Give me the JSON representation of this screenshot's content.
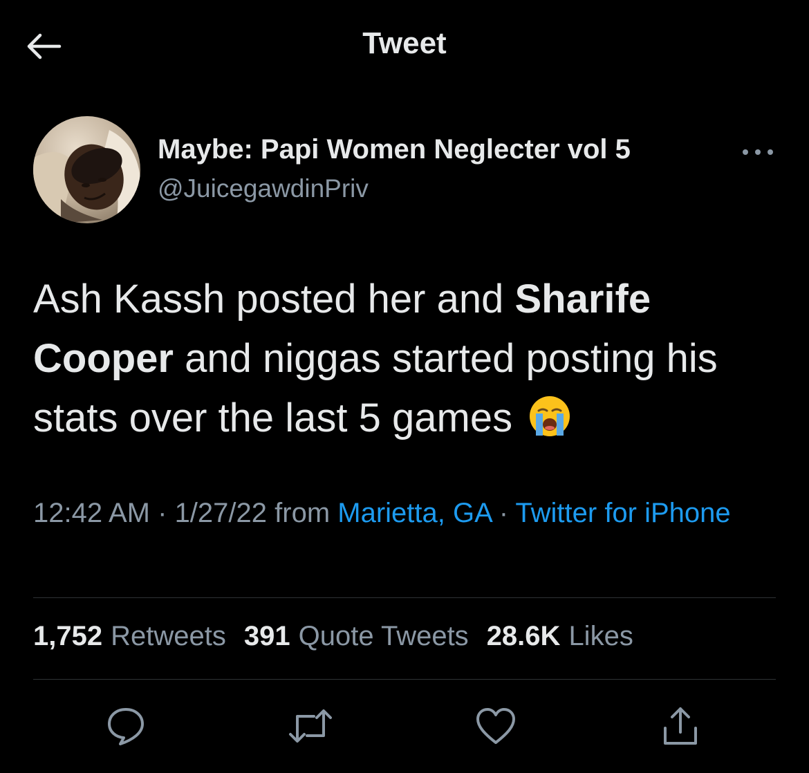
{
  "header": {
    "back_icon": "arrow-left-icon",
    "title": "Tweet"
  },
  "author": {
    "name": "Maybe: Papi Women Neglecter vol 5",
    "handle": "@JuicegawdinPriv",
    "avatar_icon": "profile-photo",
    "more_icon": "more-horizontal-icon"
  },
  "tweet": {
    "text_1": "Ash Kassh posted her and ",
    "text_bold": "Sharife Cooper",
    "text_2": " and niggas started posting his stats over the last 5 games",
    "emoji": "loudly-crying-face"
  },
  "meta": {
    "time": "12:42 AM",
    "sep1": " · ",
    "date": "1/27/22",
    "from": " from ",
    "location": "Marietta, GA",
    "sep2": " · ",
    "source": "Twitter for iPhone"
  },
  "stats": {
    "retweets_count": "1,752",
    "retweets_label": "Retweets",
    "quotes_count": "391",
    "quotes_label": "Quote Tweets",
    "likes_count": "28.6K",
    "likes_label": "Likes"
  },
  "actions": {
    "reply_icon": "reply-icon",
    "retweet_icon": "retweet-icon",
    "like_icon": "heart-icon",
    "share_icon": "share-icon"
  },
  "colors": {
    "background": "#000000",
    "text": "#e7e9ea",
    "secondary": "#8b98a5",
    "link": "#1d9bf0",
    "divider": "#2f3336"
  }
}
